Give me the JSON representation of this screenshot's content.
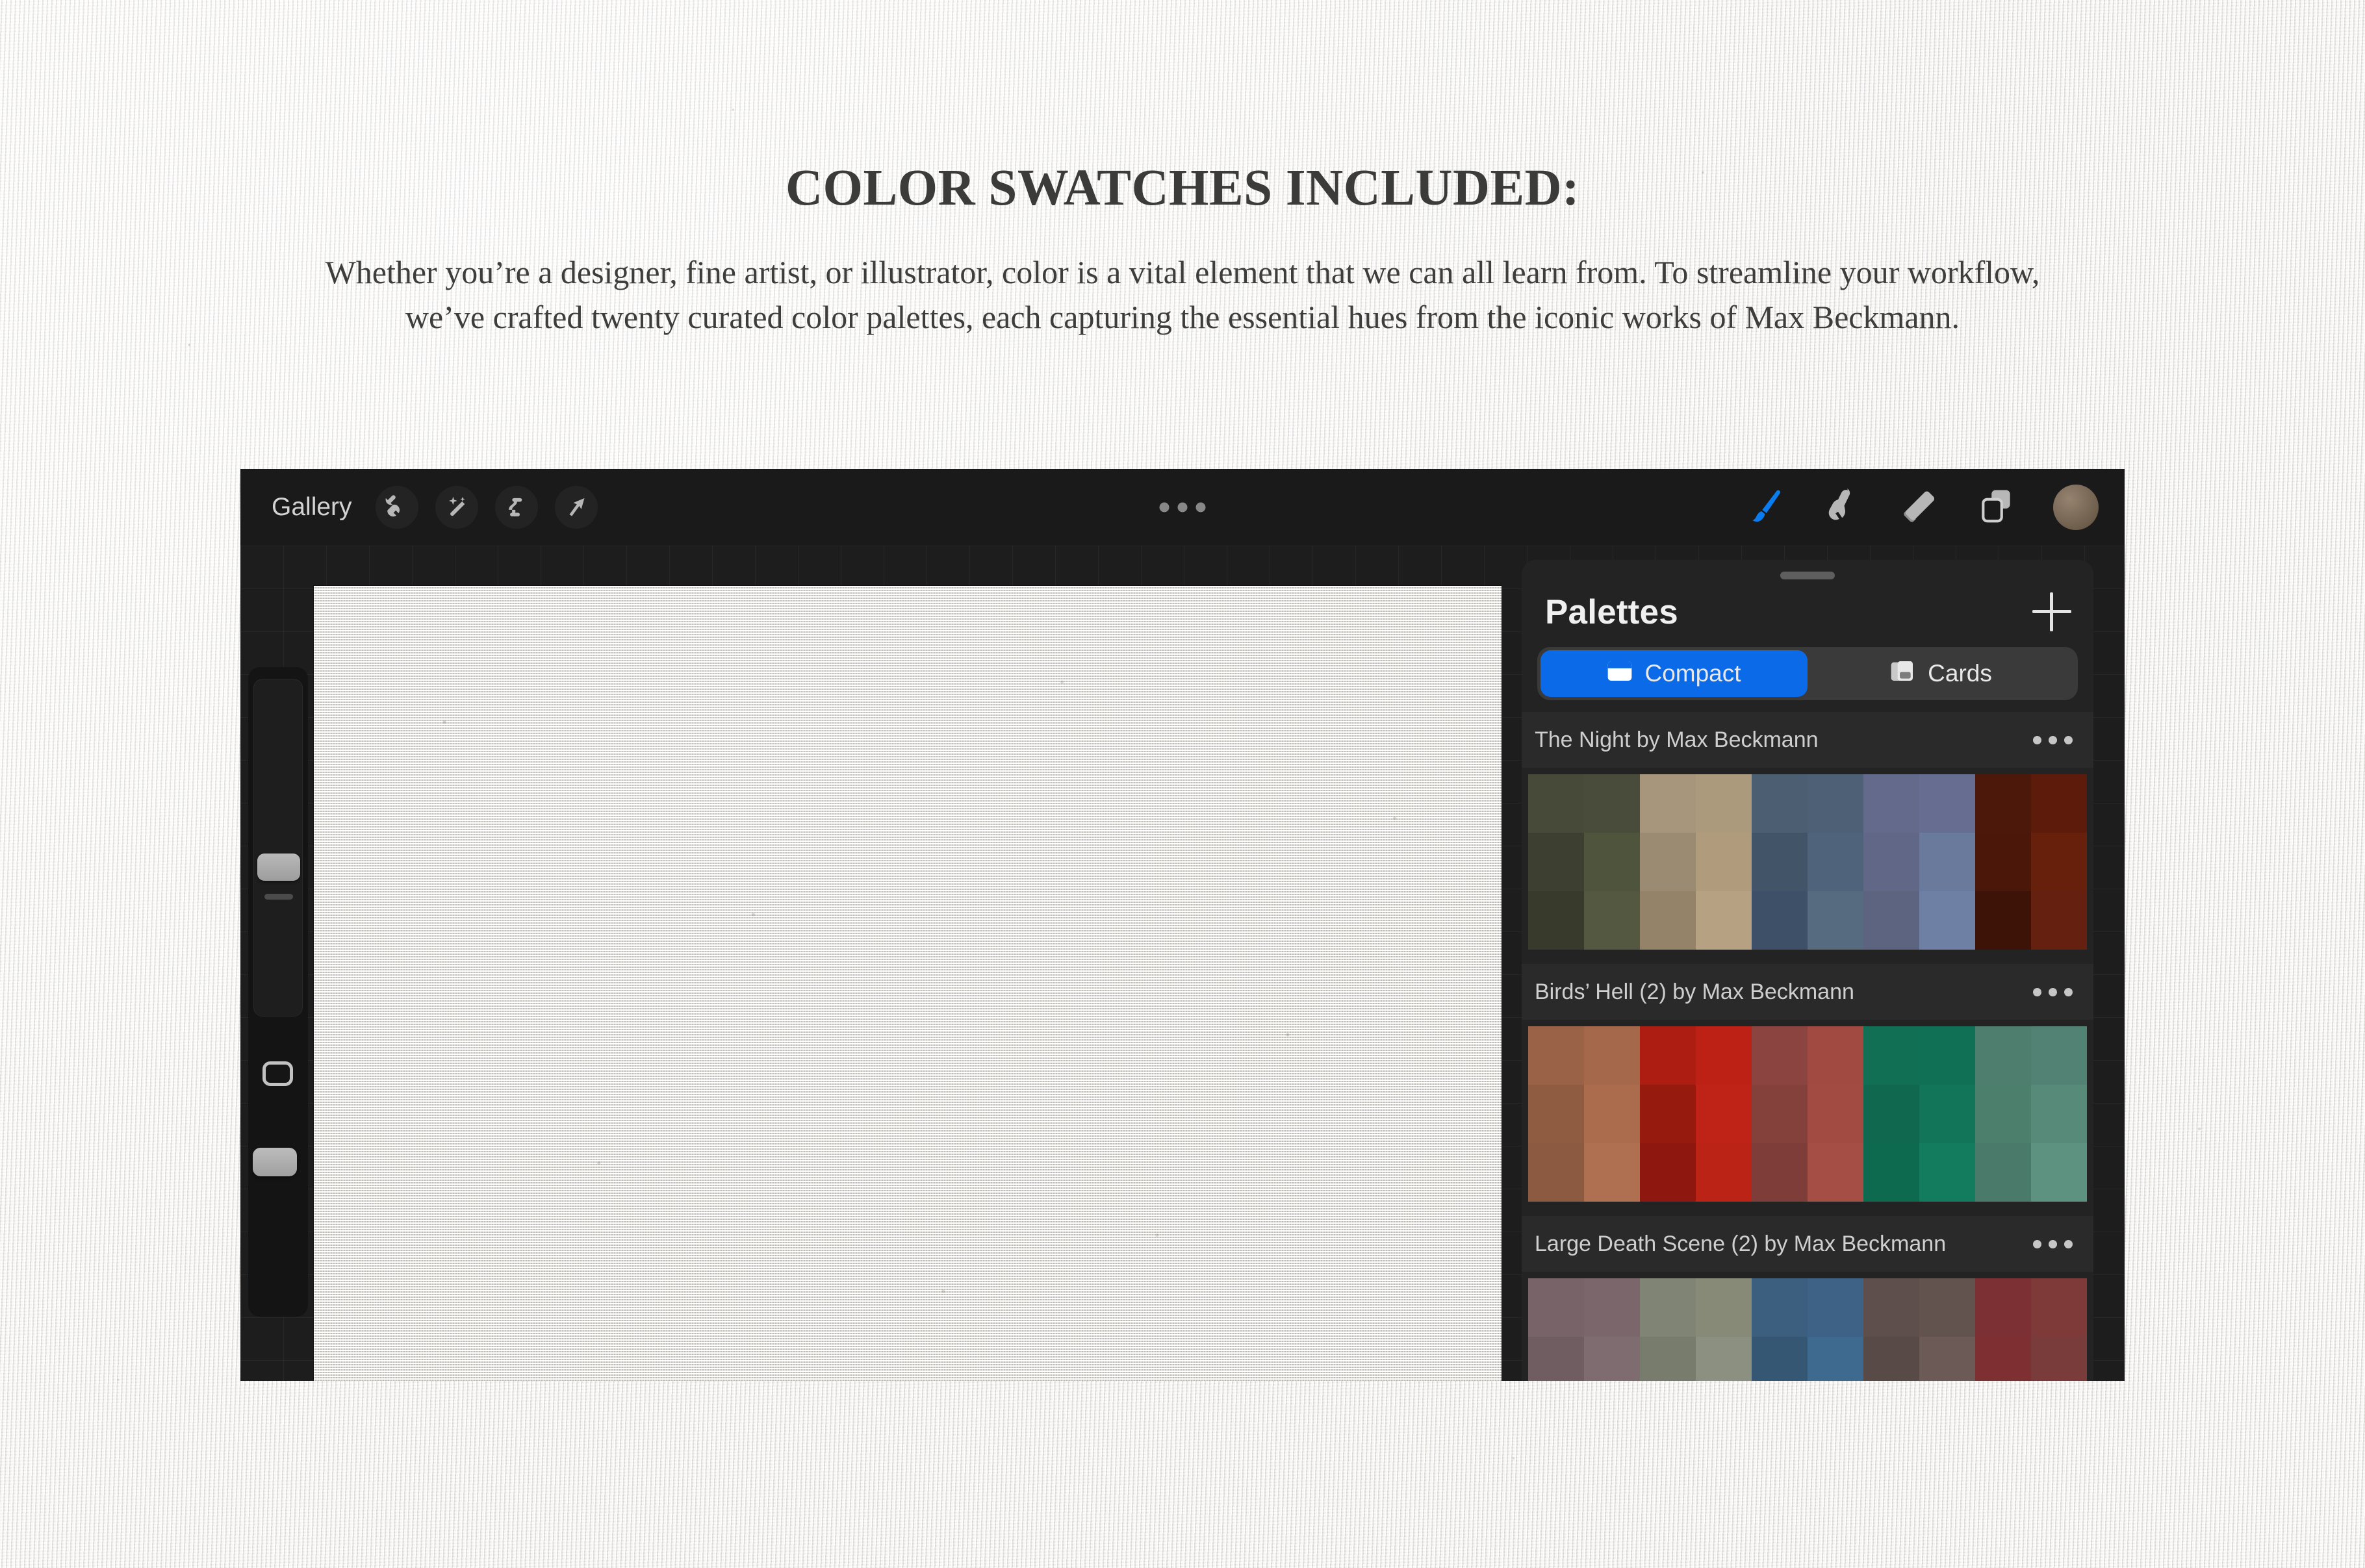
{
  "page": {
    "headline": "COLOR SWATCHES INCLUDED:",
    "body": "Whether you’re a designer, fine artist, or illustrator, color is a vital element that we can all learn from. To streamline your workflow, we’ve crafted twenty curated color palettes, each capturing the essential hues from the iconic works of Max Beckmann."
  },
  "toolbar": {
    "gallery_label": "Gallery",
    "left_tools": [
      {
        "name": "actions-wrench-icon",
        "label": "Actions"
      },
      {
        "name": "adjustments-magic-wand-icon",
        "label": "Adjustments"
      },
      {
        "name": "selection-s-curve-icon",
        "label": "Selection"
      },
      {
        "name": "transform-arrow-icon",
        "label": "Transform"
      }
    ],
    "overflow_menu": "overflow-menu-icon",
    "right_tools": [
      {
        "name": "paint-brush-icon",
        "label": "Paint",
        "active": true,
        "color": "#0a7cf0"
      },
      {
        "name": "smudge-finger-icon",
        "label": "Smudge",
        "active": false,
        "color": "#b7b7b7"
      },
      {
        "name": "eraser-icon",
        "label": "Erase",
        "active": false,
        "color": "#b7b7b7"
      },
      {
        "name": "layers-icon",
        "label": "Layers",
        "active": false,
        "color": "#b7b7b7"
      }
    ],
    "color_swatch": {
      "name": "color-swatch-button",
      "color": "#6e5e4c"
    }
  },
  "sidebar": {
    "brush_size_label": "Brush size",
    "modify_label": "Modify",
    "opacity_label": "Opacity"
  },
  "panel": {
    "title": "Palettes",
    "add_button_label": "+",
    "view_modes": [
      {
        "label": "Compact",
        "icon": "compact-view-icon",
        "active": true
      },
      {
        "label": "Cards",
        "icon": "cards-view-icon",
        "active": false
      }
    ],
    "accent_color": "#0a6ae8",
    "palettes": [
      {
        "name": "The Night by Max Beckmann",
        "menu_icon": "more-options-icon",
        "columns": 10,
        "rows": 3,
        "swatches": [
          [
            "#474a38",
            "#494c3a",
            "#a7967b",
            "#ac9a7d",
            "#4c5e72",
            "#4d6075",
            "#636a8c",
            "#666d90",
            "#4c1809",
            "#5d1c0b"
          ],
          [
            "#3d4030",
            "#4f543c",
            "#9c8b73",
            "#b09c7d",
            "#415468",
            "#4f637a",
            "#616887",
            "#6a7a9c",
            "#4a1708",
            "#66200c"
          ],
          [
            "#383a2b",
            "#545841",
            "#948369",
            "#b6a183",
            "#3d5067",
            "#576b80",
            "#5d6480",
            "#6e80a4",
            "#3d1207",
            "#652010"
          ]
        ]
      },
      {
        "name": "Birds’ Hell (2) by Max Beckmann",
        "menu_icon": "more-options-icon",
        "columns": 10,
        "rows": 3,
        "swatches": [
          [
            "#9a6348",
            "#a5684a",
            "#ae1d11",
            "#bd2116",
            "#8b4440",
            "#a04a42",
            "#116f53",
            "#0f7055",
            "#4e7f6e",
            "#518273"
          ],
          [
            "#8f5c41",
            "#aa6c4d",
            "#971a0e",
            "#bf2217",
            "#84413c",
            "#a24b43",
            "#10684e",
            "#12755a",
            "#4d7f6d",
            "#588a79"
          ],
          [
            "#8b5a40",
            "#ae7050",
            "#8e1810",
            "#bc2317",
            "#7f3d39",
            "#a44e45",
            "#0e6a4f",
            "#137b5e",
            "#4a7a6a",
            "#5d9180"
          ]
        ]
      },
      {
        "name": "Large Death Scene (2) by Max Beckmann",
        "menu_icon": "more-options-icon",
        "columns": 10,
        "rows": 3,
        "swatches": [
          [
            "#786468",
            "#7b676b",
            "#808474",
            "#868a77",
            "#3c5f7f",
            "#3d6285",
            "#5e4f4d",
            "#63534f",
            "#7c3033",
            "#7e3a39"
          ],
          [
            "#6f5d61",
            "#7f6c70",
            "#787c6d",
            "#8b9080",
            "#365774",
            "#3f6a90",
            "#584a47",
            "#6b5a56",
            "#7d2f31",
            "#7a3c3a"
          ],
          [
            "#6b5a5e",
            "#7a6a6e",
            "#74786a",
            "#898e7e",
            "#325170",
            "#3e6a8f",
            "#554744",
            "#685754",
            "#7a2e30",
            "#763b39"
          ]
        ]
      }
    ]
  }
}
